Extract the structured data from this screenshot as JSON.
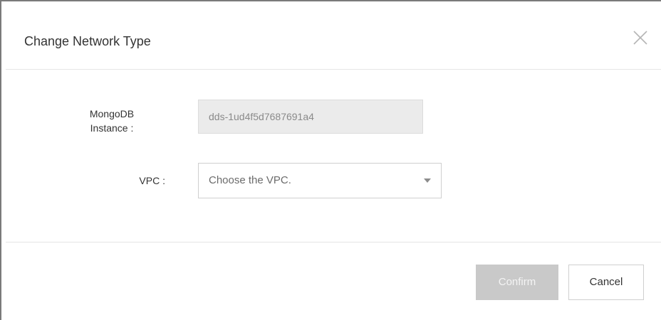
{
  "dialog": {
    "title": "Change Network Type",
    "close_icon": "close-icon"
  },
  "form": {
    "instance": {
      "label_line1": "MongoDB",
      "label_line2": "Instance :",
      "value": "dds-1ud4f5d7687691a4"
    },
    "vpc": {
      "label": "VPC :",
      "placeholder": "Choose the VPC.",
      "caret_icon": "caret-down-icon"
    }
  },
  "footer": {
    "confirm_label": "Confirm",
    "cancel_label": "Cancel"
  },
  "colors": {
    "confirm_disabled_bg": "#c9c9c9",
    "input_disabled_bg": "#ebebeb",
    "divider": "#e5e5e5"
  }
}
